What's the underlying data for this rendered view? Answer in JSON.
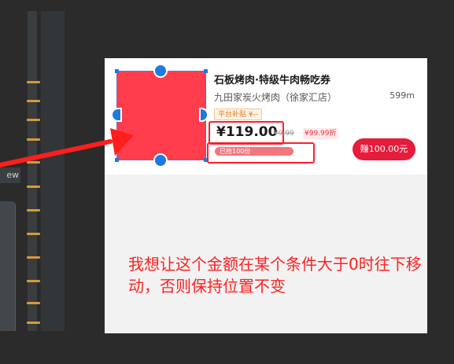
{
  "editor": {
    "view_tab_label": "ew"
  },
  "card": {
    "title": "石板烤肉·特级牛肉畅吃券",
    "shop_name": "九田家炭火烤肉（徐家汇店）",
    "distance": "599m",
    "subsidy_tag": "平台补贴 ¥--",
    "price": "¥119.00",
    "original_price": "¥9.99",
    "discount_tag": "¥99.99折",
    "sold_text": "已抢100份",
    "earn_button": "赚100.00元"
  },
  "annotation": {
    "note": "我想让这个金额在某个条件大于0时往下移动，否则保持位置不变"
  },
  "colors": {
    "accent_red": "#ff1e2d",
    "earn_button": "#e51c3b",
    "handle_blue": "#1f7ae0",
    "ruler_tick": "#d49a3a"
  },
  "icons": [
    "selection-handle",
    "arrow-annotation"
  ]
}
